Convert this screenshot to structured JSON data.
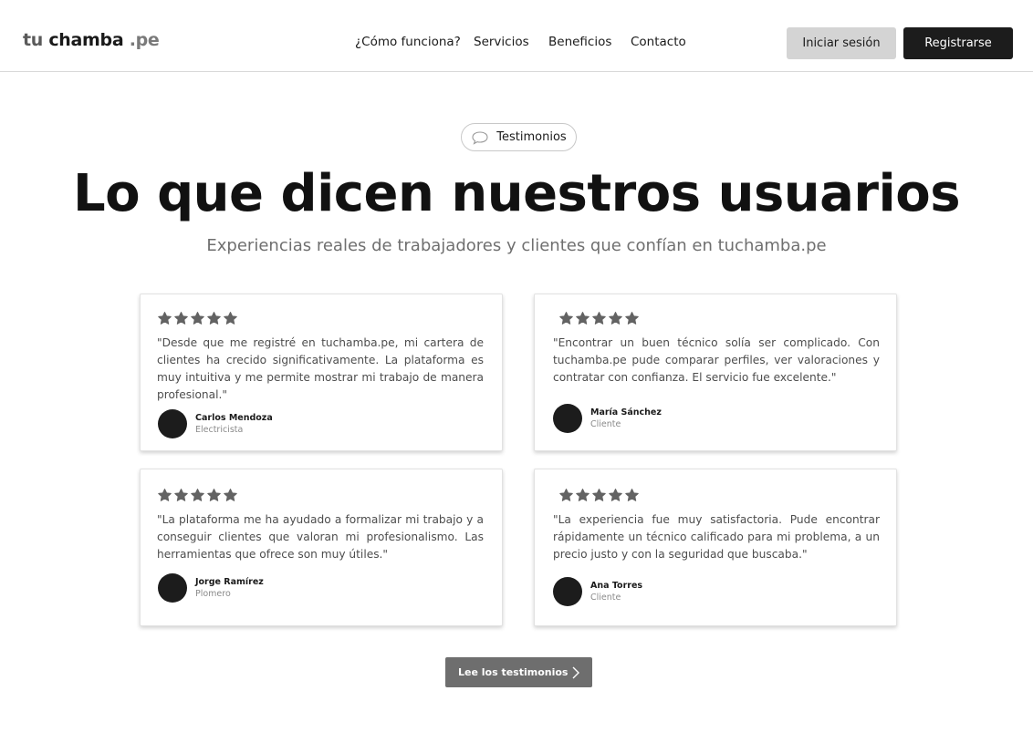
{
  "header": {
    "logo": {
      "part1": "tu",
      "part2": "chamba",
      "part3": ".pe"
    },
    "nav": [
      {
        "label": "¿Cómo funciona?"
      },
      {
        "label": "Servicios"
      },
      {
        "label": "Beneficios"
      },
      {
        "label": "Contacto"
      }
    ],
    "login_label": "Iniciar sesión",
    "register_label": "Registrarse"
  },
  "hero": {
    "badge_label": "Testimonios",
    "badge_icon": "speech-bubble-icon",
    "title": "Lo que dicen nuestros usuarios",
    "subtitle": "Experiencias reales de trabajadores y clientes que confían en tuchamba.pe"
  },
  "testimonials": [
    {
      "rating": 5,
      "quote": "\"Desde que me registré en tuchamba.pe, mi cartera de clientes ha crecido significativamente. La plataforma es muy intuitiva y me permite mostrar mi trabajo de manera profesional.\"",
      "name": "Carlos Mendoza",
      "role": "Electricista"
    },
    {
      "rating": 5,
      "quote": "\"Encontrar un buen técnico solía ser complicado. Con tuchamba.pe pude comparar perfiles, ver valoraciones y contratar con confianza. El servicio fue excelente.\"",
      "name": "María Sánchez",
      "role": "Cliente"
    },
    {
      "rating": 5,
      "quote": "\"La plataforma me ha ayudado a formalizar mi trabajo y a conseguir clientes que valoran mi profesionalismo. Las herramientas que ofrece son muy útiles.\"",
      "name": "Jorge Ramírez",
      "role": "Plomero"
    },
    {
      "rating": 5,
      "quote": "\"La experiencia fue muy satisfactoria. Pude encontrar rápidamente un técnico calificado para mi problema, a un precio justo y con la seguridad que buscaba.\"",
      "name": "Ana Torres",
      "role": "Cliente"
    }
  ],
  "cta": {
    "label": "Lee los testimonios",
    "icon": "chevron-right-icon"
  },
  "colors": {
    "primary": "#1c1c1c",
    "star": "#636363",
    "cta": "#6e6e6e",
    "secondary_button": "#d4d4d4"
  }
}
